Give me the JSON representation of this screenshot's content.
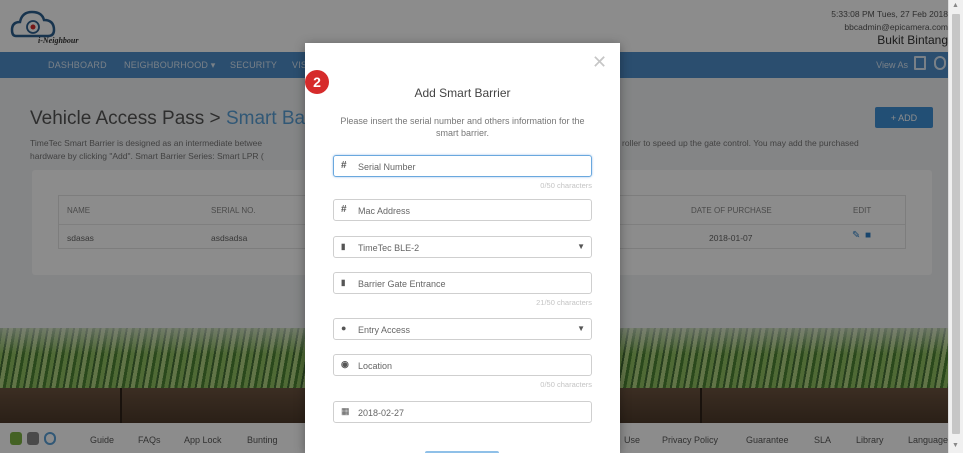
{
  "header": {
    "logo_text": "i-Neighbour",
    "datetime": "5:33:08 PM Tues, 27 Feb 2018",
    "email": "bbcadmin@epicamera.com",
    "area": "Bukit Bintang"
  },
  "nav": {
    "items": [
      "DASHBOARD",
      "NEIGHBOURHOOD ▾",
      "SECURITY",
      "VIS"
    ],
    "view_as": "View As"
  },
  "page": {
    "title": "Vehicle Access Pass",
    "separator": ">",
    "crumb": "Smart Barri",
    "desc_line1": "TimeTec Smart Barrier is designed as an intermediate betwee",
    "desc_line1_right": "roller to speed up the gate control. You may add the purchased",
    "desc_line2": "hardware by clicking \"Add\". Smart Barrier Series: Smart LPR (",
    "add_button": "+ ADD"
  },
  "table": {
    "headers": [
      "NAME",
      "SERIAL NO.",
      "DATE OF PURCHASE",
      "EDIT"
    ],
    "rows": [
      {
        "name": "sdasas",
        "serial": "asdsadsa",
        "date": "2018-01-07"
      }
    ]
  },
  "footer": {
    "links": [
      "Guide",
      "FAQs",
      "App Lock",
      "Bunting"
    ],
    "links_right": [
      "Use",
      "Privacy Policy",
      "Guarantee",
      "SLA",
      "Library",
      "Language"
    ]
  },
  "modal": {
    "step": "2",
    "title": "Add Smart Barrier",
    "subtitle": "Please insert the serial number and others information for the smart barrier.",
    "fields": {
      "serial_placeholder": "Serial Number",
      "serial_counter": "0/50 characters",
      "mac_placeholder": "Mac Address",
      "model_value": "TimeTec BLE-2",
      "name_value": "Barrier Gate Entrance",
      "name_counter": "21/50 characters",
      "access_value": "Entry Access",
      "location_placeholder": "Location",
      "location_counter": "0/50 characters",
      "date_value": "2018-02-27"
    }
  },
  "colors": {
    "nav": "#4f8fcb",
    "accent": "#3f90d6",
    "badge": "#d62b2b"
  }
}
